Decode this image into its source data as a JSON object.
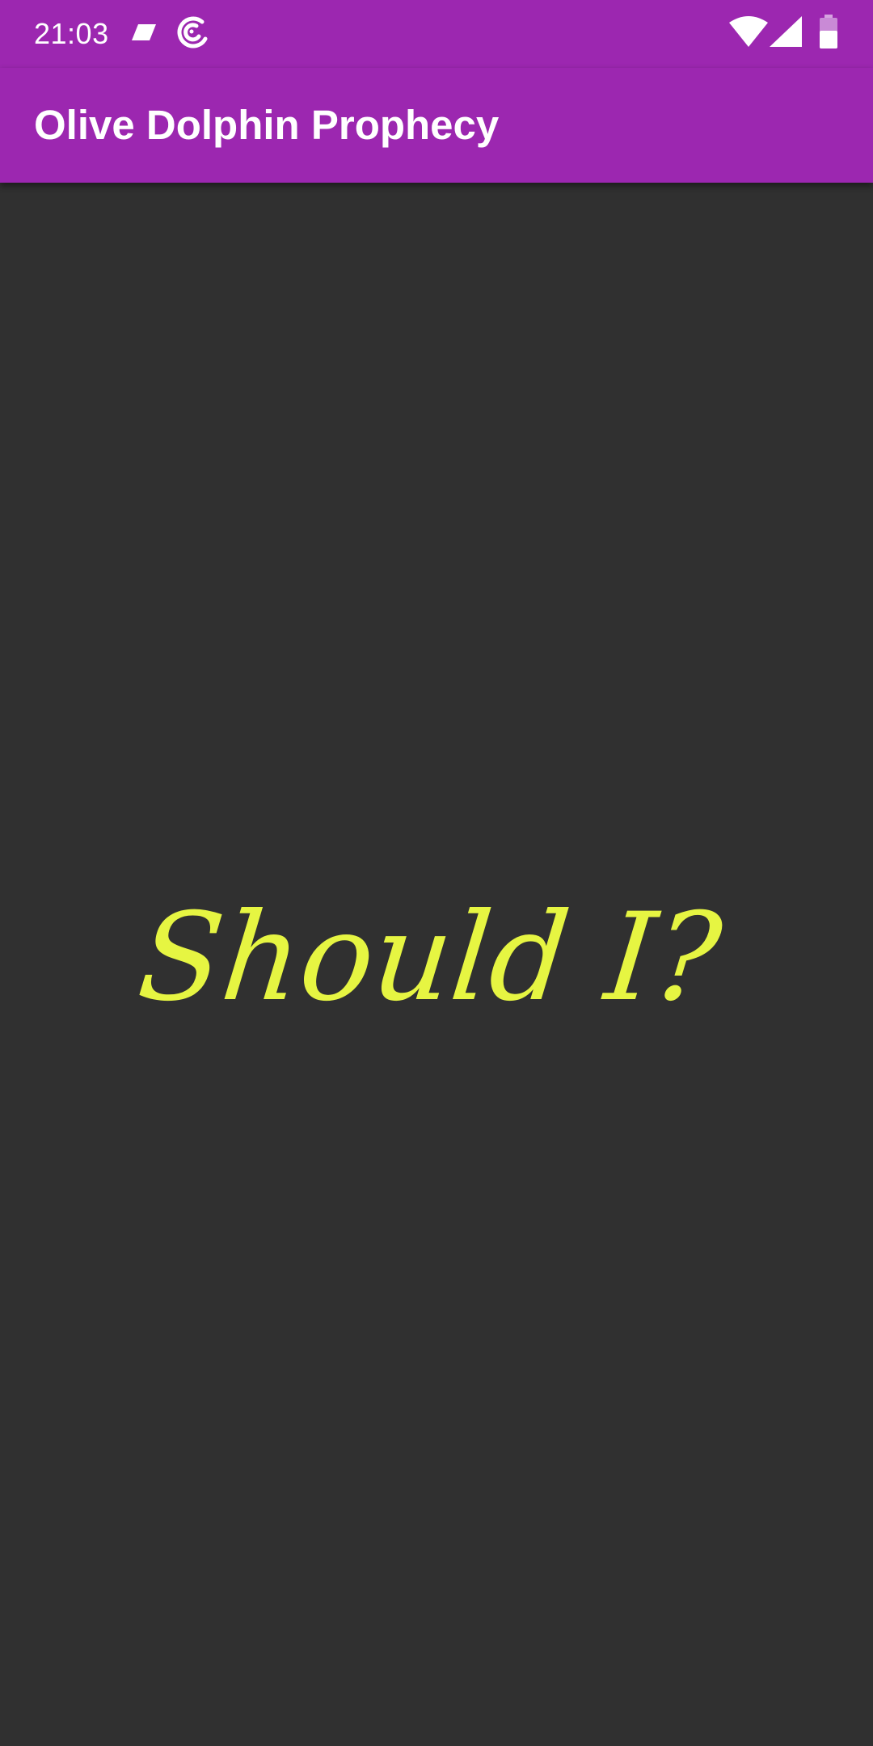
{
  "status_bar": {
    "time": "21:03",
    "left_icons": [
      "notification-parallelogram-icon",
      "sync-arc-icon"
    ],
    "right_icons": [
      "wifi-icon",
      "cellular-signal-icon",
      "battery-icon"
    ]
  },
  "app_bar": {
    "title": "Olive Dolphin Prophecy"
  },
  "main": {
    "answer": "Should I?"
  },
  "colors": {
    "app_bar": "#9c27b0",
    "background": "#303030",
    "answer_text": "#e6f542",
    "status_text": "#ffffff"
  }
}
